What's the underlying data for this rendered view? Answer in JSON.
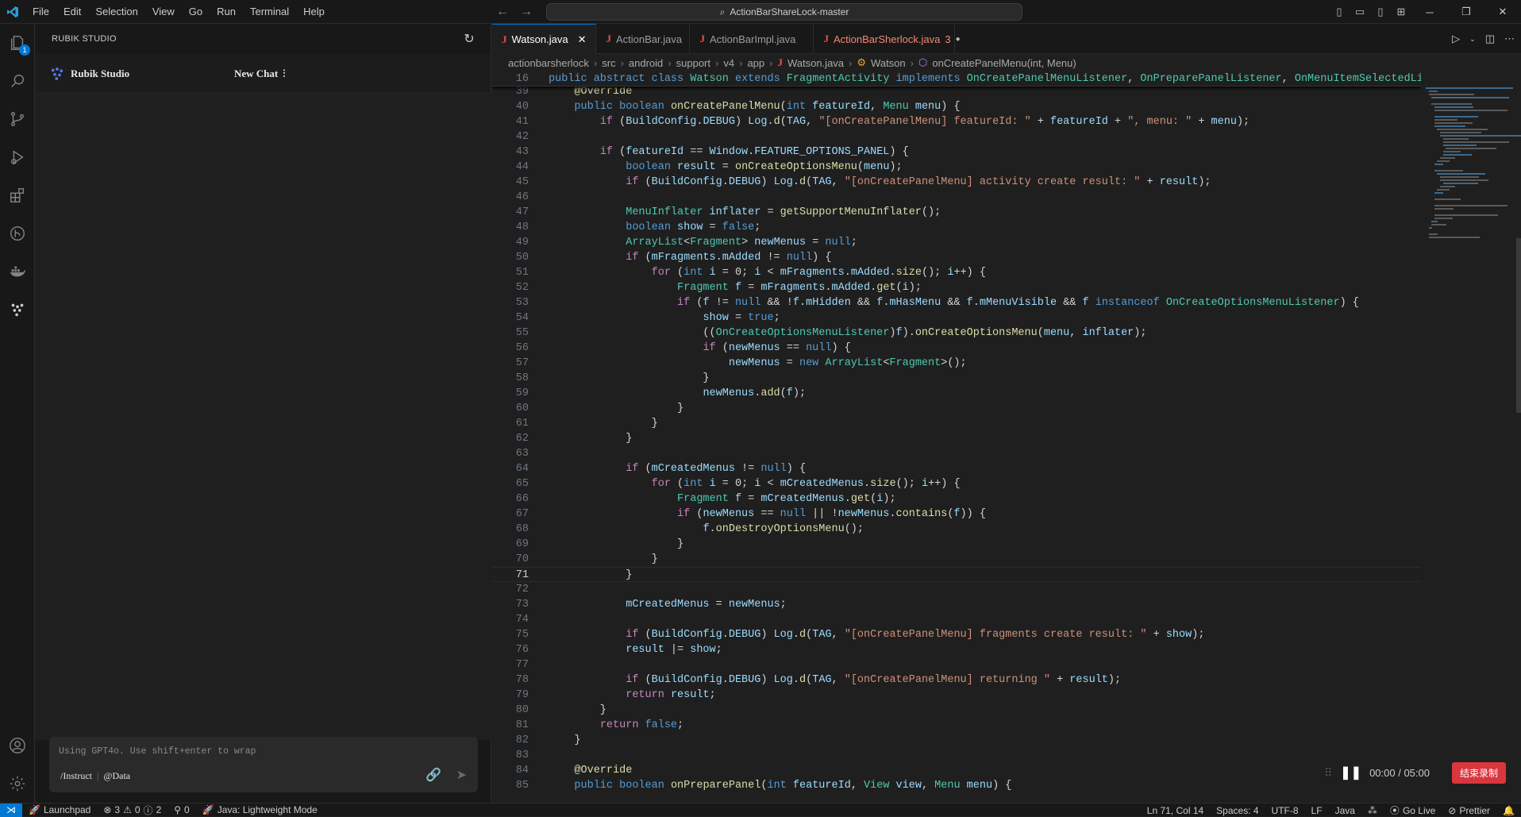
{
  "menu": [
    "File",
    "Edit",
    "Selection",
    "View",
    "Go",
    "Run",
    "Terminal",
    "Help"
  ],
  "command_center": "ActionBarShareLock-master",
  "activity": {
    "explorer_badge": "1"
  },
  "sidebar": {
    "header": "RUBIK STUDIO",
    "brand": "Rubik Studio",
    "new_chat": "New Chat",
    "input_placeholder": "Using GPT4o. Use shift+enter to wrap",
    "instruct": "/Instruct",
    "data_cmd": "@Data"
  },
  "tabs": [
    {
      "label": "Watson.java",
      "active": true
    },
    {
      "label": "ActionBar.java"
    },
    {
      "label": "ActionBarImpl.java"
    },
    {
      "label": "ActionBarSherlock.java",
      "problems": "3"
    }
  ],
  "breadcrumb": [
    "actionbarsherlock",
    "src",
    "android",
    "support",
    "v4",
    "app",
    "Watson.java",
    "Watson",
    "onCreatePanelMenu(int, Menu)"
  ],
  "code": [
    {
      "n": "16",
      "sticky": true,
      "html": "<span class=\"kw\">public abstract class</span> <span class=\"ty\">Watson</span> <span class=\"kw\">extends</span> <span class=\"ty\">FragmentActivity</span> <span class=\"kw\">implements</span> <span class=\"ty\">OnCreatePanelMenuListener</span>, <span class=\"ty\">OnPreparePanelListener</span>, <span class=\"ty\">OnMenuItemSelectedListener</span>"
    },
    {
      "n": "39",
      "html": "    <span class=\"an\">@Override</span>"
    },
    {
      "n": "40",
      "html": "    <span class=\"kw\">public boolean</span> <span class=\"fn\">onCreatePanelMenu</span>(<span class=\"kw\">int</span> <span class=\"vr\">featureId</span>, <span class=\"ty\">Menu</span> <span class=\"vr\">menu</span>) {"
    },
    {
      "n": "41",
      "html": "        <span class=\"ctl\">if</span> (<span class=\"vr\">BuildConfig</span>.<span class=\"vr\">DEBUG</span>) <span class=\"vr\">Log</span>.<span class=\"fn\">d</span>(<span class=\"vr\">TAG</span>, <span class=\"st\">\"[onCreatePanelMenu] featureId: \"</span> + <span class=\"vr\">featureId</span> + <span class=\"st\">\", menu: \"</span> + <span class=\"vr\">menu</span>);"
    },
    {
      "n": "42",
      "html": ""
    },
    {
      "n": "43",
      "html": "        <span class=\"ctl\">if</span> (<span class=\"vr\">featureId</span> == <span class=\"vr\">Window</span>.<span class=\"vr\">FEATURE_OPTIONS_PANEL</span>) {"
    },
    {
      "n": "44",
      "html": "            <span class=\"kw\">boolean</span> <span class=\"vr\">result</span> = <span class=\"fn\">onCreateOptionsMenu</span>(<span class=\"vr\">menu</span>);"
    },
    {
      "n": "45",
      "html": "            <span class=\"ctl\">if</span> (<span class=\"vr\">BuildConfig</span>.<span class=\"vr\">DEBUG</span>) <span class=\"vr\">Log</span>.<span class=\"fn\">d</span>(<span class=\"vr\">TAG</span>, <span class=\"st\">\"[onCreatePanelMenu] activity create result: \"</span> + <span class=\"vr\">result</span>);"
    },
    {
      "n": "46",
      "html": ""
    },
    {
      "n": "47",
      "html": "            <span class=\"ty\">MenuInflater</span> <span class=\"vr\">inflater</span> = <span class=\"fn\">getSupportMenuInflater</span>();"
    },
    {
      "n": "48",
      "html": "            <span class=\"kw\">boolean</span> <span class=\"vr\">show</span> = <span class=\"kw\">false</span>;"
    },
    {
      "n": "49",
      "html": "            <span class=\"ty\">ArrayList</span>&lt;<span class=\"ty\">Fragment</span>&gt; <span class=\"vr\">newMenus</span> = <span class=\"kw\">null</span>;"
    },
    {
      "n": "50",
      "html": "            <span class=\"ctl\">if</span> (<span class=\"vr\">mFragments</span>.<span class=\"vr\">mAdded</span> != <span class=\"kw\">null</span>) {"
    },
    {
      "n": "51",
      "html": "                <span class=\"ctl\">for</span> (<span class=\"kw\">int</span> <span class=\"vr\">i</span> = <span class=\"pl\">0</span>; <span class=\"vr\">i</span> &lt; <span class=\"vr\">mFragments</span>.<span class=\"vr\">mAdded</span>.<span class=\"fn\">size</span>(); <span class=\"vr\">i</span>++) {"
    },
    {
      "n": "52",
      "html": "                    <span class=\"ty\">Fragment</span> <span class=\"vr\">f</span> = <span class=\"vr\">mFragments</span>.<span class=\"vr\">mAdded</span>.<span class=\"fn\">get</span>(<span class=\"vr\">i</span>);"
    },
    {
      "n": "53",
      "html": "                    <span class=\"ctl\">if</span> (<span class=\"vr\">f</span> != <span class=\"kw\">null</span> &amp;&amp; !<span class=\"vr\">f</span>.<span class=\"vr\">mHidden</span> &amp;&amp; <span class=\"vr\">f</span>.<span class=\"vr\">mHasMenu</span> &amp;&amp; <span class=\"vr\">f</span>.<span class=\"vr\">mMenuVisible</span> &amp;&amp; <span class=\"vr\">f</span> <span class=\"kw\">instanceof</span> <span class=\"ty\">OnCreateOptionsMenuListener</span>) {"
    },
    {
      "n": "54",
      "html": "                        <span class=\"vr\">show</span> = <span class=\"kw\">true</span>;"
    },
    {
      "n": "55",
      "html": "                        ((<span class=\"ty\">OnCreateOptionsMenuListener</span>)<span class=\"vr\">f</span>).<span class=\"fn\">onCreateOptionsMenu</span>(<span class=\"vr\">menu</span>, <span class=\"vr\">inflater</span>);"
    },
    {
      "n": "56",
      "html": "                        <span class=\"ctl\">if</span> (<span class=\"vr\">newMenus</span> == <span class=\"kw\">null</span>) {"
    },
    {
      "n": "57",
      "html": "                            <span class=\"vr\">newMenus</span> = <span class=\"kw\">new</span> <span class=\"ty\">ArrayList</span>&lt;<span class=\"ty\">Fragment</span>&gt;();"
    },
    {
      "n": "58",
      "html": "                        }"
    },
    {
      "n": "59",
      "html": "                        <span class=\"vr\">newMenus</span>.<span class=\"fn\">add</span>(<span class=\"vr\">f</span>);"
    },
    {
      "n": "60",
      "html": "                    }"
    },
    {
      "n": "61",
      "html": "                }"
    },
    {
      "n": "62",
      "html": "            }"
    },
    {
      "n": "63",
      "html": ""
    },
    {
      "n": "64",
      "html": "            <span class=\"ctl\">if</span> (<span class=\"vr\">mCreatedMenus</span> != <span class=\"kw\">null</span>) {"
    },
    {
      "n": "65",
      "html": "                <span class=\"ctl\">for</span> (<span class=\"kw\">int</span> <span class=\"vr\">i</span> = <span class=\"pl\">0</span>; <span class=\"vr\">i</span> &lt; <span class=\"vr\">mCreatedMenus</span>.<span class=\"fn\">size</span>(); <span class=\"vr\">i</span>++) {"
    },
    {
      "n": "66",
      "html": "                    <span class=\"ty\">Fragment</span> <span class=\"vr\">f</span> = <span class=\"vr\">mCreatedMenus</span>.<span class=\"fn\">get</span>(<span class=\"vr\">i</span>);"
    },
    {
      "n": "67",
      "html": "                    <span class=\"ctl\">if</span> (<span class=\"vr\">newMenus</span> == <span class=\"kw\">null</span> || !<span class=\"vr\">newMenus</span>.<span class=\"fn\">contains</span>(<span class=\"vr\">f</span>)) {"
    },
    {
      "n": "68",
      "html": "                        <span class=\"vr\">f</span>.<span class=\"fn\">onDestroyOptionsMenu</span>();"
    },
    {
      "n": "69",
      "html": "                    }"
    },
    {
      "n": "70",
      "html": "                }"
    },
    {
      "n": "71",
      "current": true,
      "html": "            }"
    },
    {
      "n": "72",
      "html": ""
    },
    {
      "n": "73",
      "html": "            <span class=\"vr\">mCreatedMenus</span> = <span class=\"vr\">newMenus</span>;"
    },
    {
      "n": "74",
      "html": ""
    },
    {
      "n": "75",
      "html": "            <span class=\"ctl\">if</span> (<span class=\"vr\">BuildConfig</span>.<span class=\"vr\">DEBUG</span>) <span class=\"vr\">Log</span>.<span class=\"fn\">d</span>(<span class=\"vr\">TAG</span>, <span class=\"st\">\"[onCreatePanelMenu] fragments create result: \"</span> + <span class=\"vr\">show</span>);"
    },
    {
      "n": "76",
      "html": "            <span class=\"vr\">result</span> |= <span class=\"vr\">show</span>;"
    },
    {
      "n": "77",
      "html": ""
    },
    {
      "n": "78",
      "html": "            <span class=\"ctl\">if</span> (<span class=\"vr\">BuildConfig</span>.<span class=\"vr\">DEBUG</span>) <span class=\"vr\">Log</span>.<span class=\"fn\">d</span>(<span class=\"vr\">TAG</span>, <span class=\"st\">\"[onCreatePanelMenu] returning \"</span> + <span class=\"vr\">result</span>);"
    },
    {
      "n": "79",
      "html": "            <span class=\"ctl\">return</span> <span class=\"vr\">result</span>;"
    },
    {
      "n": "80",
      "html": "        }"
    },
    {
      "n": "81",
      "html": "        <span class=\"ctl\">return</span> <span class=\"kw\">false</span>;"
    },
    {
      "n": "82",
      "html": "    }"
    },
    {
      "n": "83",
      "html": ""
    },
    {
      "n": "84",
      "html": "    <span class=\"an\">@Override</span>"
    },
    {
      "n": "85",
      "html": "    <span class=\"kw\">public boolean</span> <span class=\"fn\">onPreparePanel</span>(<span class=\"kw\">int</span> <span class=\"vr\">featureId</span>, <span class=\"ty\">View</span> <span class=\"vr\">view</span>, <span class=\"ty\">Menu</span> <span class=\"vr\">menu</span>) {"
    }
  ],
  "recorder": {
    "time": "00:00 / 05:00",
    "stop": "结束录制"
  },
  "status": {
    "launchpad": "Launchpad",
    "errors": "3",
    "warnings": "0",
    "infos": "2",
    "ports": "0",
    "java": "Java: Lightweight Mode",
    "position": "Ln 71, Col 14",
    "spaces": "Spaces: 4",
    "encoding": "UTF-8",
    "eol": "LF",
    "language": "Java",
    "golive": "Go Live",
    "prettier": "Prettier"
  }
}
